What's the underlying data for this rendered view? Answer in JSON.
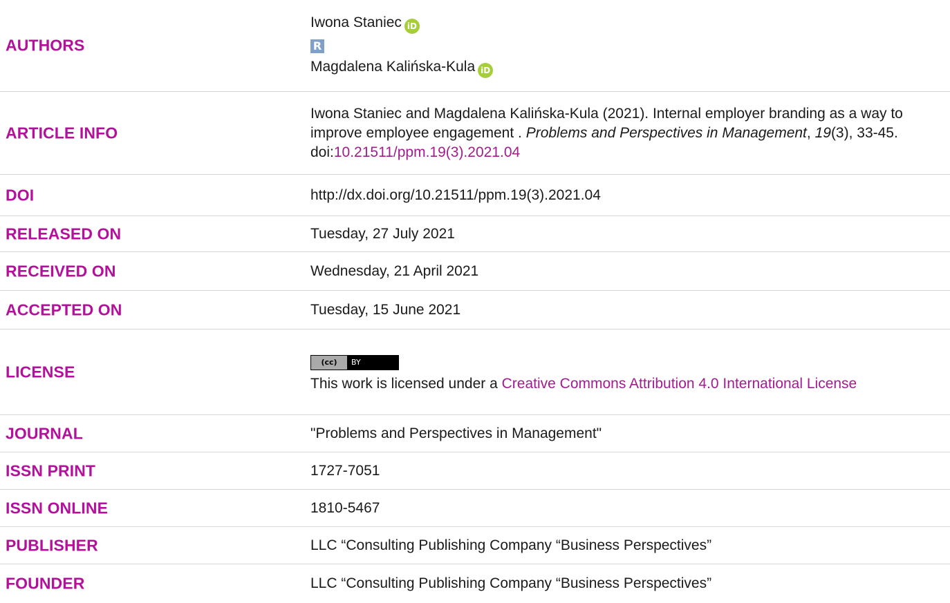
{
  "authors": {
    "label": "AUTHORS",
    "names": [
      "Iwona Staniec",
      "Magdalena Kalińska-Kula"
    ],
    "orcid_glyph": "iD",
    "researcherid_glyph": "R"
  },
  "article_info": {
    "label": "ARTICLE INFO",
    "text_1": "Iwona Staniec and Magdalena Kalińska-Kula (2021). Internal employer branding as a way to improve employee engagement . ",
    "journal_italic": "Problems and Perspectives in Management",
    "sep_1": ", ",
    "volume_italic": "19",
    "text_2": "(3), 33-45. doi:",
    "doi_link": "10.21511/ppm.19(3).2021.04"
  },
  "doi": {
    "label": "DOI",
    "value": "http://dx.doi.org/10.21511/ppm.19(3).2021.04"
  },
  "released": {
    "label": "RELEASED ON",
    "value": "Tuesday, 27 July 2021"
  },
  "received": {
    "label": "RECEIVED ON",
    "value": "Wednesday, 21 April 2021"
  },
  "accepted": {
    "label": "ACCEPTED ON",
    "value": "Tuesday, 15 June 2021"
  },
  "license": {
    "label": "LICENSE",
    "badge_left": "(cc)",
    "badge_right": "BY",
    "text": "This work is licensed under a ",
    "link": "Creative Commons Attribution 4.0 International License"
  },
  "journal": {
    "label": "JOURNAL",
    "value": "\"Problems and Perspectives in Management\""
  },
  "issn_print": {
    "label": "ISSN PRINT",
    "value": "1727-7051"
  },
  "issn_online": {
    "label": "ISSN ONLINE",
    "value": "1810-5467"
  },
  "publisher": {
    "label": "PUBLISHER",
    "value": "LLC “Consulting Publishing Company “Business Perspectives”"
  },
  "founder": {
    "label": "FOUNDER",
    "value": "LLC “Consulting Publishing Company “Business Perspectives”"
  },
  "colors": {
    "label": "#b3109b",
    "link": "#a21b8f",
    "orcid": "#a6ce39",
    "researcherid": "#7fa0c8"
  }
}
